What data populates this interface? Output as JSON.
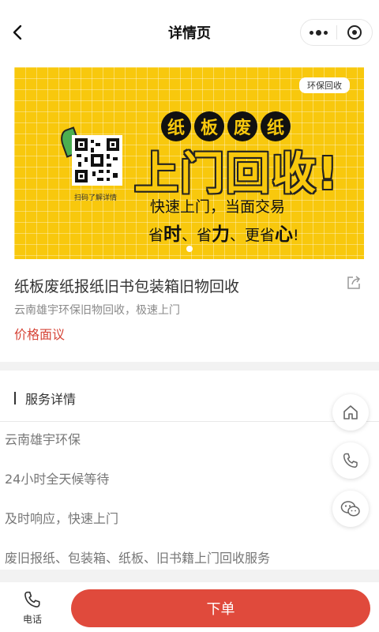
{
  "nav": {
    "title": "详情页"
  },
  "banner": {
    "tag": "环保回收",
    "circle_chars": [
      "纸",
      "板",
      "废",
      "纸"
    ],
    "big_title": "上门回收!",
    "qr_caption": "扫码了解详情",
    "line1": "快速上门，当面交易",
    "line2": {
      "a": "省",
      "b": "时",
      "c": "、省",
      "d": "力",
      "e": "、更省",
      "f": "心",
      "g": "!"
    },
    "accent_color": "#f8c80d"
  },
  "product": {
    "title": "纸板废纸报纸旧书包装箱旧物回收",
    "subtitle": "云南雄宇环保旧物回收，极速上门",
    "price": "价格面议",
    "price_color": "#d64538"
  },
  "service": {
    "heading": "服务详情",
    "lines": [
      "云南雄宇环保",
      "24小时全天候等待",
      "及时响应，快速上门",
      "废旧报纸、包装箱、纸板、旧书籍上门回收服务"
    ]
  },
  "bottom": {
    "phone_label": "电话",
    "order_label": "下单",
    "order_color": "#e04a3c"
  },
  "icons": {
    "back": "chevron-left-icon",
    "more": "more-dots-icon",
    "close": "target-circle-icon",
    "share": "share-icon",
    "home": "home-icon",
    "phone": "phone-icon",
    "wechat": "wechat-icon"
  }
}
